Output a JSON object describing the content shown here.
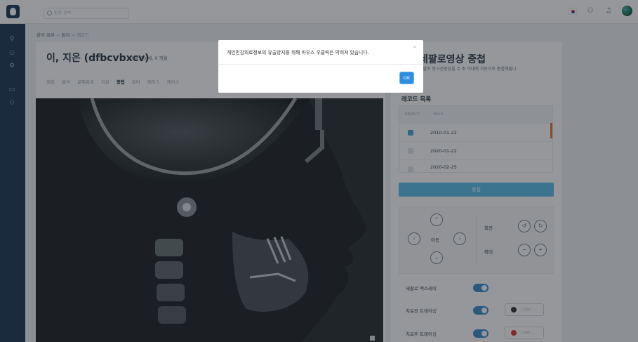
{
  "topbar": {
    "search_placeholder": "환자 검색",
    "icons": [
      "flag-kr-icon",
      "users-icon",
      "bell-icon",
      "globe-icon"
    ]
  },
  "sidebar": {
    "icons": [
      "user-icon",
      "users-icon",
      "settings-icon",
      "layout-icon",
      "tag-icon"
    ]
  },
  "breadcrumb": {
    "items": [
      "환자 목록",
      "환자",
      "레코드"
    ],
    "separator": ">"
  },
  "patient": {
    "name": "이, 지은 (dfbcvbxcv)",
    "info": "여자   10 세, 0 개월"
  },
  "tabs": [
    "계측",
    "분석",
    "문제목록",
    "치료",
    "중첩",
    "뷰어",
    "페이스",
    "케이스"
  ],
  "active_tab": "중첩",
  "panel": {
    "title": "세팔로영상 중첩",
    "description": "세팔로 방사선영상을 수 초 이내에 자동으로 중첩해줍니",
    "records_title": "레코드 목록",
    "table_headers": [
      "SELECT",
      "레코드"
    ],
    "records": [
      {
        "date": "2010-01-22",
        "selected": true
      },
      {
        "date": "2020-01-22",
        "selected": false
      },
      {
        "date": "2020-02-25",
        "selected": false
      }
    ],
    "overlay_button": "중첩",
    "controls": {
      "move_label": "이동",
      "rotate_label": "회전",
      "zoom_label": "확대"
    },
    "options": [
      {
        "label": "세팔로 엑스레이",
        "enabled": true
      },
      {
        "label": "치료전 트레이싱",
        "enabled": true,
        "color_label": "Color",
        "color": "#333333"
      },
      {
        "label": "치료후 트레이싱",
        "enabled": true,
        "color_label": "Color",
        "color": "#e0342f"
      }
    ]
  },
  "modal": {
    "message": "개인민감의료정보의 유출방지를 위해 마우스 우클릭은 막혀져 있습니다.",
    "ok_label": "OK"
  },
  "colors": {
    "sidebar_bg": "#1f3b57",
    "accent": "#2f8ee0",
    "overlay_button": "#5cc0ea",
    "toggle_on": "#3d8fd0"
  }
}
